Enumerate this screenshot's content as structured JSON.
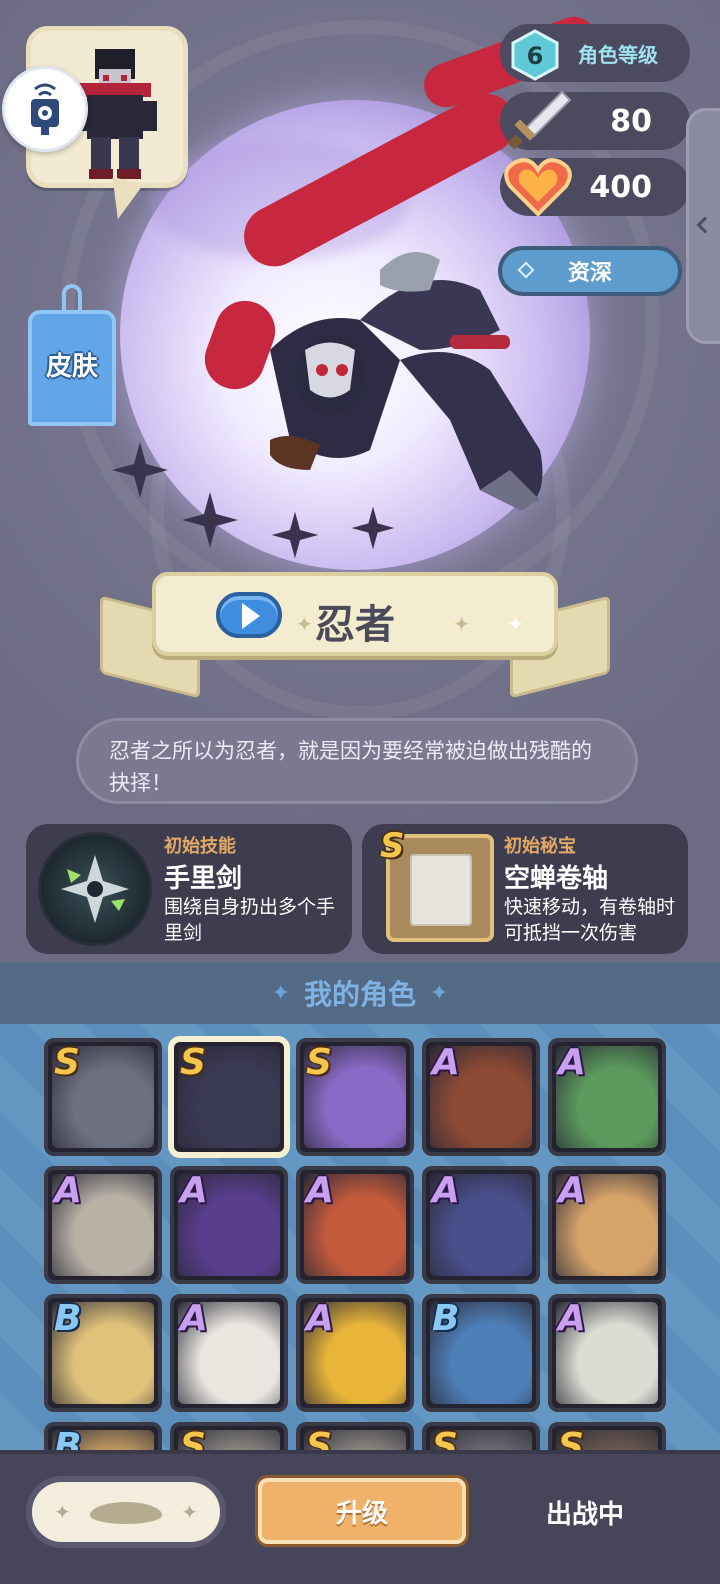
{
  "hero": {
    "name": "忍者",
    "description": "忍者之所以为忍者，就是因为要经常被迫做出残酷的抉择！",
    "skin_label": "皮肤"
  },
  "stats": {
    "level_value": "6",
    "level_label": "角色等级",
    "attack": "80",
    "health": "400",
    "rank": "资深"
  },
  "skill": {
    "label": "初始技能",
    "title": "手里剑",
    "desc": "围绕自身扔出多个手里剑"
  },
  "treasure": {
    "label": "初始秘宝",
    "title": "空蝉卷轴",
    "desc": "快速移动，有卷轴时可抵挡一次伤害",
    "tier": "S"
  },
  "roster": {
    "title": "我的角色",
    "characters": [
      {
        "tier": "S",
        "color": "#6d7080"
      },
      {
        "tier": "S",
        "color": "#3b3a55",
        "selected": true
      },
      {
        "tier": "S",
        "color": "#8a6ac6"
      },
      {
        "tier": "A",
        "color": "#8c4a34"
      },
      {
        "tier": "A",
        "color": "#5b9a5c"
      },
      {
        "tier": "A",
        "color": "#b7b1a6"
      },
      {
        "tier": "A",
        "color": "#5a3e8e"
      },
      {
        "tier": "A",
        "color": "#c45a3c"
      },
      {
        "tier": "A",
        "color": "#4a4f8c"
      },
      {
        "tier": "A",
        "color": "#d6a36a"
      },
      {
        "tier": "B",
        "color": "#e0c27a"
      },
      {
        "tier": "A",
        "color": "#e9e6e0"
      },
      {
        "tier": "A",
        "color": "#e8b53a"
      },
      {
        "tier": "B",
        "color": "#4f7fb8"
      },
      {
        "tier": "A",
        "color": "#d9ddd2"
      },
      {
        "tier": "B",
        "color": "#c9a064"
      },
      {
        "tier": "S",
        "color": "#8e8a84"
      },
      {
        "tier": "S",
        "color": "#8e8a84"
      },
      {
        "tier": "S",
        "color": "#6e6c74"
      },
      {
        "tier": "S",
        "color": "#6e5c50"
      }
    ]
  },
  "bottom": {
    "upgrade_label": "升级",
    "status_label": "出战中"
  },
  "icons": {
    "nfc": "nfc-tag-icon",
    "level": "hexagon-level-icon",
    "attack": "sword-icon",
    "health": "heart-icon",
    "play": "play-icon",
    "side_tab": "chevron-left-icon"
  },
  "colors": {
    "accent_gold": "#e2a866",
    "rank_blue": "#5d9ccc",
    "upgrade_orange": "#f0b26a",
    "roster_bg": "#5f93c1"
  }
}
